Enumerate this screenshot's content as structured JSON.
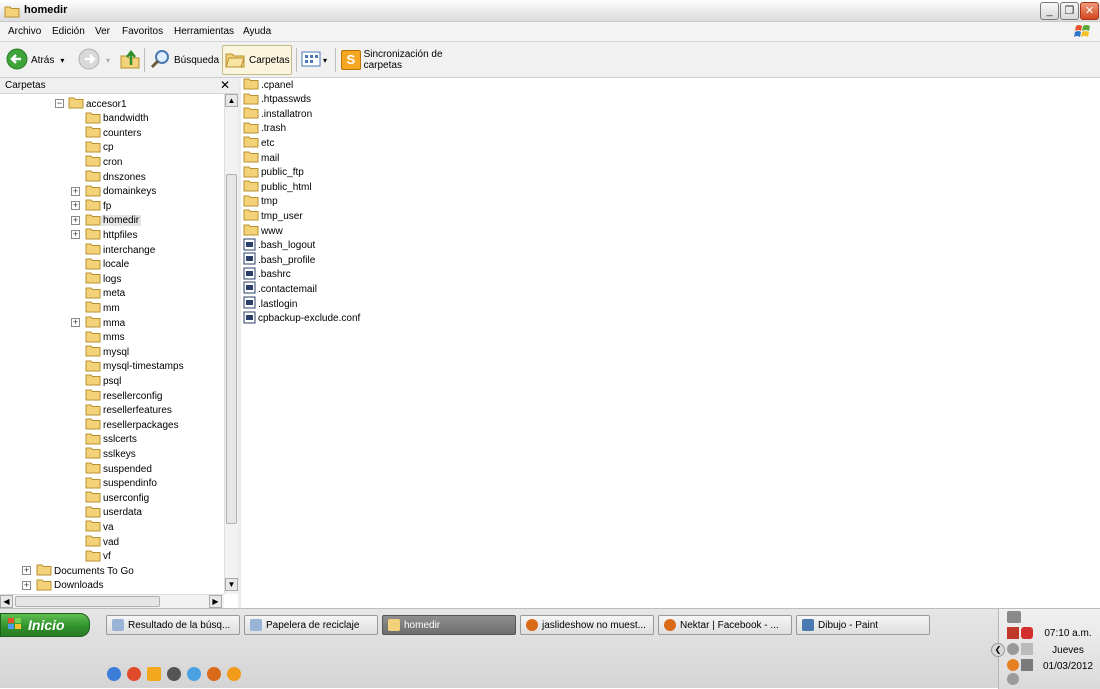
{
  "window": {
    "title": "homedir",
    "controls": {
      "minimize": "_",
      "maximize": "❐",
      "close": "✕"
    }
  },
  "menu": [
    "Archivo",
    "Edición",
    "Ver",
    "Favoritos",
    "Herramientas",
    "Ayuda"
  ],
  "toolbar": {
    "back_label": "Atrás",
    "search_label": "Búsqueda",
    "folders_label": "Carpetas",
    "sync_label": "Sincronización de carpetas",
    "sync_glyph": "S",
    "dropdown_glyph": "▾"
  },
  "folders_pane": {
    "title": "Carpetas",
    "close_glyph": "✕",
    "expand_glyph": "+",
    "collapse_glyph": "−",
    "scroll_up": "▲",
    "scroll_down": "▼",
    "scroll_left": "◀",
    "scroll_right": "▶",
    "tree": [
      {
        "label": "accesor1",
        "level": 1,
        "expander": "minus"
      },
      {
        "label": "bandwidth",
        "level": 2,
        "expander": "none"
      },
      {
        "label": "counters",
        "level": 2,
        "expander": "none"
      },
      {
        "label": "cp",
        "level": 2,
        "expander": "none"
      },
      {
        "label": "cron",
        "level": 2,
        "expander": "none"
      },
      {
        "label": "dnszones",
        "level": 2,
        "expander": "none"
      },
      {
        "label": "domainkeys",
        "level": 2,
        "expander": "plus"
      },
      {
        "label": "fp",
        "level": 2,
        "expander": "plus"
      },
      {
        "label": "homedir",
        "level": 2,
        "expander": "plus",
        "selected": true
      },
      {
        "label": "httpfiles",
        "level": 2,
        "expander": "plus"
      },
      {
        "label": "interchange",
        "level": 2,
        "expander": "none"
      },
      {
        "label": "locale",
        "level": 2,
        "expander": "none"
      },
      {
        "label": "logs",
        "level": 2,
        "expander": "none"
      },
      {
        "label": "meta",
        "level": 2,
        "expander": "none"
      },
      {
        "label": "mm",
        "level": 2,
        "expander": "none"
      },
      {
        "label": "mma",
        "level": 2,
        "expander": "plus"
      },
      {
        "label": "mms",
        "level": 2,
        "expander": "none"
      },
      {
        "label": "mysql",
        "level": 2,
        "expander": "none"
      },
      {
        "label": "mysql-timestamps",
        "level": 2,
        "expander": "none"
      },
      {
        "label": "psql",
        "level": 2,
        "expander": "none"
      },
      {
        "label": "resellerconfig",
        "level": 2,
        "expander": "none"
      },
      {
        "label": "resellerfeatures",
        "level": 2,
        "expander": "none"
      },
      {
        "label": "resellerpackages",
        "level": 2,
        "expander": "none"
      },
      {
        "label": "sslcerts",
        "level": 2,
        "expander": "none"
      },
      {
        "label": "sslkeys",
        "level": 2,
        "expander": "none"
      },
      {
        "label": "suspended",
        "level": 2,
        "expander": "none"
      },
      {
        "label": "suspendinfo",
        "level": 2,
        "expander": "none"
      },
      {
        "label": "userconfig",
        "level": 2,
        "expander": "none"
      },
      {
        "label": "userdata",
        "level": 2,
        "expander": "none"
      },
      {
        "label": "va",
        "level": 2,
        "expander": "none"
      },
      {
        "label": "vad",
        "level": 2,
        "expander": "none"
      },
      {
        "label": "vf",
        "level": 2,
        "expander": "none"
      },
      {
        "label": "Documents To Go",
        "level": 0,
        "expander": "plus"
      },
      {
        "label": "Downloads",
        "level": 0,
        "expander": "plus"
      }
    ]
  },
  "content": {
    "items": [
      {
        "name": ".cpanel",
        "type": "folder"
      },
      {
        "name": ".htpasswds",
        "type": "folder"
      },
      {
        "name": ".installatron",
        "type": "folder"
      },
      {
        "name": ".trash",
        "type": "folder"
      },
      {
        "name": "etc",
        "type": "folder"
      },
      {
        "name": "mail",
        "type": "folder"
      },
      {
        "name": "public_ftp",
        "type": "folder"
      },
      {
        "name": "public_html",
        "type": "folder"
      },
      {
        "name": "tmp",
        "type": "folder"
      },
      {
        "name": "tmp_user",
        "type": "folder"
      },
      {
        "name": "www",
        "type": "folder"
      },
      {
        "name": ".bash_logout",
        "type": "file"
      },
      {
        "name": ".bash_profile",
        "type": "file"
      },
      {
        "name": ".bashrc",
        "type": "file"
      },
      {
        "name": ".contactemail",
        "type": "file"
      },
      {
        "name": ".lastlogin",
        "type": "file"
      },
      {
        "name": "cpbackup-exclude.conf",
        "type": "file"
      }
    ]
  },
  "taskbar": {
    "start_label": "Inicio",
    "tasks": [
      {
        "label": "Resultado de la búsq...",
        "icon": "search-results-icon"
      },
      {
        "label": "Papelera de reciclaje",
        "icon": "recycle-bin-icon"
      },
      {
        "label": "homedir",
        "icon": "folder-icon",
        "active": true
      },
      {
        "label": "jaslideshow no muest...",
        "icon": "firefox-icon"
      },
      {
        "label": "Nektar | Facebook - ...",
        "icon": "firefox-icon"
      },
      {
        "label": "Dibujo - Paint",
        "icon": "paint-icon"
      }
    ],
    "tray": {
      "time": "07:10 a.m.",
      "day": "Jueves",
      "date": "01/03/2012",
      "collapse_glyph": "❮"
    }
  },
  "colors": {
    "folder_fill": "#f3d27a",
    "folder_stroke": "#b8912f",
    "start_green": "#3a9a33",
    "selection": "#e4e4e4"
  }
}
